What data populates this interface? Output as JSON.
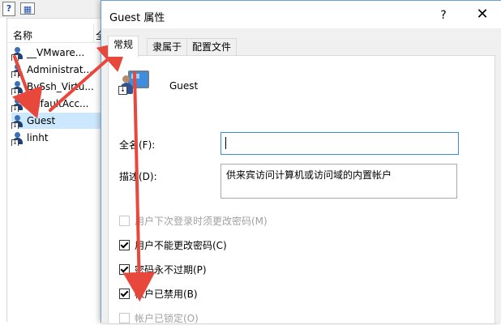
{
  "toolbar": {
    "help_icon_glyph": "?",
    "panel_icon_glyph": "▦"
  },
  "list": {
    "columns": [
      "名称",
      "全"
    ],
    "rows": [
      {
        "name": "__VMware...",
        "extra": ""
      },
      {
        "name": "Administrat...",
        "extra": ""
      },
      {
        "name": "BvSsh_Virtu...",
        "extra": "B"
      },
      {
        "name": "DefaultAcc...",
        "extra": ""
      },
      {
        "name": "Guest",
        "extra": ""
      },
      {
        "name": "linht",
        "extra": ""
      }
    ],
    "selected_index": 4
  },
  "dialog": {
    "title": "Guest 属性",
    "help_label": "?",
    "close_label": "✕",
    "tabs": [
      "常规",
      "隶属于",
      "配置文件"
    ],
    "active_tab": 0,
    "user_name": "Guest",
    "full_name_label": "全名(F):",
    "full_name_value": "",
    "description_label": "描述(D):",
    "description_value": "供来宾访问计算机或访问域的内置帐户",
    "options": [
      {
        "label": "用户下次登录时须更改密码(M)",
        "checked": false,
        "disabled": true
      },
      {
        "label": "用户不能更改密码(C)",
        "checked": true,
        "disabled": false
      },
      {
        "label": "密码永不过期(P)",
        "checked": true,
        "disabled": false
      },
      {
        "label": "帐户已禁用(B)",
        "checked": true,
        "disabled": false
      },
      {
        "label": "帐户已锁定(O)",
        "checked": false,
        "disabled": true
      }
    ]
  },
  "annotation_color": "#e8473c"
}
